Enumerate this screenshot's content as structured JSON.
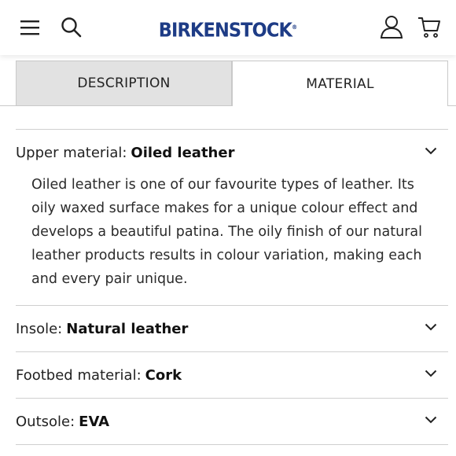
{
  "header": {
    "logo_text": "BIRKENSTOCK",
    "logo_mark": "®",
    "brand_color": "#1e3c86",
    "icons": {
      "menu": "hamburger-menu-icon",
      "search": "search-icon",
      "account": "account-icon",
      "cart": "cart-icon"
    }
  },
  "tabs": [
    {
      "label": "DESCRIPTION",
      "active": false
    },
    {
      "label": "MATERIAL",
      "active": true
    }
  ],
  "materials": [
    {
      "label": "Upper material:",
      "value": "Oiled leather",
      "expanded": true,
      "description": "Oiled leather is one of our favourite types of leather. Its oily waxed surface makes for a unique colour effect and develops a beautiful patina. The oily finish of our natural leather products results in colour variation, making each and every pair unique."
    },
    {
      "label": "Insole:",
      "value": "Natural leather",
      "expanded": false
    },
    {
      "label": "Footbed material:",
      "value": "Cork",
      "expanded": false
    },
    {
      "label": "Outsole:",
      "value": "EVA",
      "expanded": false
    }
  ]
}
